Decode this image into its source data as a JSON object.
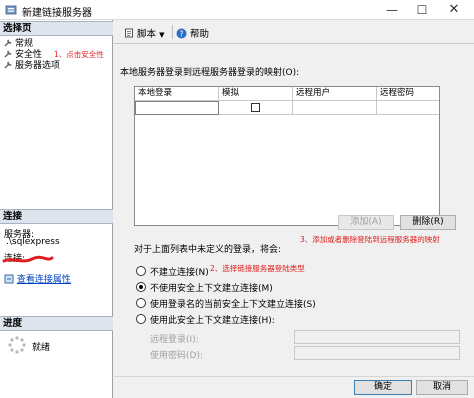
{
  "window": {
    "title": "新建链接服务器",
    "min_symbol": "—",
    "max_symbol": "☐",
    "close_symbol": "✕"
  },
  "left": {
    "select_page_header": "选择页",
    "pages": [
      {
        "label": "常规"
      },
      {
        "label": "安全性"
      },
      {
        "label": "服务器选项"
      }
    ],
    "annotation_security": "1、点击安全性",
    "connection_header": "连接",
    "server_label": "服务器:",
    "server_value": ".\\sqlexpress",
    "connection_label": "连接:",
    "view_connection_props": "查看连接属性",
    "progress_header": "进度",
    "progress_status": "就绪"
  },
  "toolbar": {
    "script_label": "脚本",
    "help_label": "帮助"
  },
  "mapping": {
    "title": "本地服务器登录到远程服务器登录的映射(O):",
    "columns": [
      "本地登录",
      "模拟",
      "远程用户",
      "远程密码"
    ],
    "add_button": "添加(A)",
    "delete_button": "删除(R)",
    "annotation": "3、添加或者删除登陆到远程服务器的映射"
  },
  "options": {
    "prompt": "对于上面列表中未定义的登录，将会:",
    "annotation": "2、选择链接服务器登陆类型",
    "radios": [
      {
        "label": "不建立连接(N)",
        "checked": false
      },
      {
        "label": "不使用安全上下文建立连接(M)",
        "checked": true
      },
      {
        "label": "使用登录名的当前安全上下文建立连接(S)",
        "checked": false
      },
      {
        "label": "使用此安全上下文建立连接(H):",
        "checked": false
      }
    ],
    "remote_login_label": "远程登录(I):",
    "password_label": "使用密码(D):"
  },
  "footer": {
    "ok_button": "确定",
    "cancel_button": "取消"
  },
  "colors": {
    "annotation": "#e02020",
    "link": "#0040c0",
    "section_header": "#dde4ee"
  }
}
